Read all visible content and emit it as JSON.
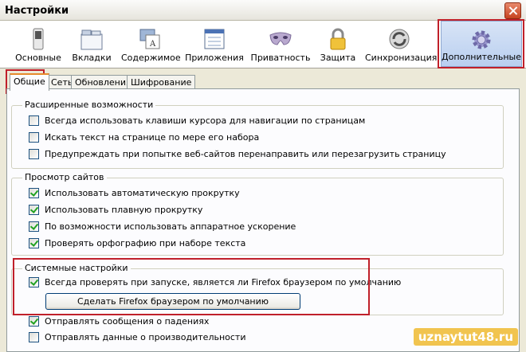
{
  "window": {
    "title": "Настройки"
  },
  "toolbar": {
    "items": [
      {
        "label": "Основные",
        "icon": "switch-icon"
      },
      {
        "label": "Вкладки",
        "icon": "tabs-icon"
      },
      {
        "label": "Содержимое",
        "icon": "content-icon"
      },
      {
        "label": "Приложения",
        "icon": "applications-icon"
      },
      {
        "label": "Приватность",
        "icon": "privacy-mask-icon"
      },
      {
        "label": "Защита",
        "icon": "lock-icon"
      },
      {
        "label": "Синхронизация",
        "icon": "sync-icon"
      },
      {
        "label": "Дополнительные",
        "icon": "gear-icon",
        "selected": true
      }
    ]
  },
  "tabs": [
    {
      "label": "Общие",
      "active": true
    },
    {
      "label": "Сеть"
    },
    {
      "label": "Обновления"
    },
    {
      "label": "Шифрование"
    }
  ],
  "groups": {
    "accessibility": {
      "title": "Расширенные возможности",
      "options": [
        {
          "label": "Всегда использовать клавиши курсора для навигации по страницам",
          "checked": false
        },
        {
          "label": "Искать текст на странице по мере его набора",
          "checked": false
        },
        {
          "label": "Предупреждать при попытке веб-сайтов перенаправить или перезагрузить страницу",
          "checked": false
        }
      ]
    },
    "browsing": {
      "title": "Просмотр сайтов",
      "options": [
        {
          "label": "Использовать автоматическую прокрутку",
          "checked": true
        },
        {
          "label": "Использовать плавную прокрутку",
          "checked": true
        },
        {
          "label": "По возможности использовать аппаратное ускорение",
          "checked": true
        },
        {
          "label": "Проверять орфографию при наборе текста",
          "checked": true
        }
      ]
    },
    "system": {
      "title": "Системные настройки",
      "options": [
        {
          "label": "Всегда проверять при запуске, является ли Firefox браузером по умолчанию",
          "checked": true
        }
      ],
      "button_label": "Сделать Firefox браузером по умолчанию"
    },
    "crash": {
      "options": [
        {
          "label": "Отправлять сообщения о падениях",
          "checked": true
        },
        {
          "label": "Отправлять данные о производительности",
          "checked": false
        }
      ]
    }
  },
  "watermark": "uznaytut48.ru",
  "colors": {
    "highlight": "#c0202a",
    "selected_toolbar": "#b9cff0",
    "check": "#21a121"
  }
}
